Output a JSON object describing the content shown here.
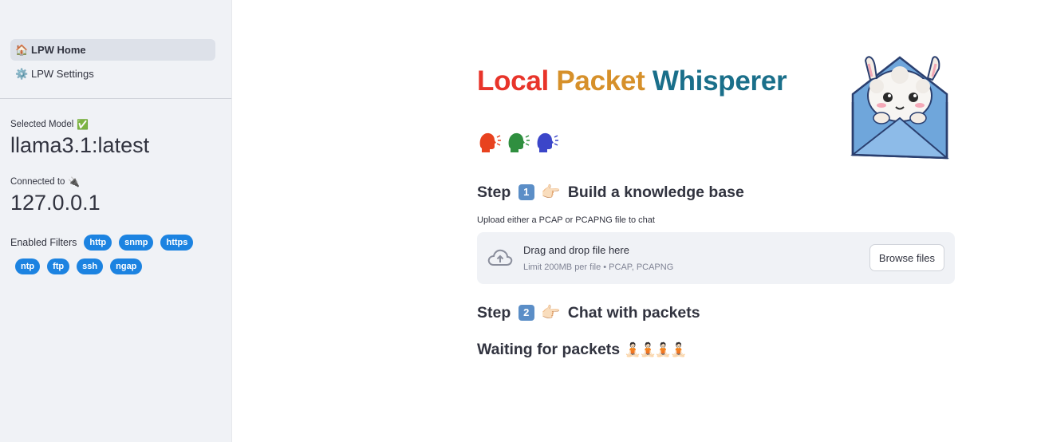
{
  "sidebar": {
    "nav": [
      {
        "icon": "🏠",
        "label": "LPW Home",
        "active": true
      },
      {
        "icon": "⚙️",
        "label": "LPW Settings",
        "active": false
      }
    ],
    "model_label": "Selected Model",
    "model_icon": "✅",
    "model_value": "llama3.1:latest",
    "connected_label": "Connected to",
    "connected_icon": "🔌",
    "connected_value": "127.0.0.1",
    "filters_label": "Enabled Filters",
    "filters": [
      "http",
      "snmp",
      "https",
      "ntp",
      "ftp",
      "ssh",
      "ngap"
    ]
  },
  "main": {
    "title_words": [
      "Local",
      "Packet",
      "Whisperer"
    ],
    "step1": {
      "prefix": "Step",
      "key": "1",
      "hand": "👉🏻",
      "text": "Build a knowledge base"
    },
    "upload_label": "Upload either a PCAP or PCAPNG file to chat",
    "dropzone": {
      "title": "Drag and drop file here",
      "limit": "Limit 200MB per file • PCAP, PCAPNG",
      "browse_label": "Browse files"
    },
    "step2": {
      "prefix": "Step",
      "key": "2",
      "hand": "👉🏻",
      "text": "Chat with packets"
    },
    "waiting_text": "Waiting for packets",
    "waiting_emoji": "🧘🏻🧘🏻🧘🏻🧘🏻"
  },
  "colors": {
    "accent": "#1c83e1",
    "sidebar_bg": "#f0f2f6",
    "title_red": "#e8342a",
    "title_orange": "#d6902a",
    "title_purple": "#5e3fc4"
  }
}
